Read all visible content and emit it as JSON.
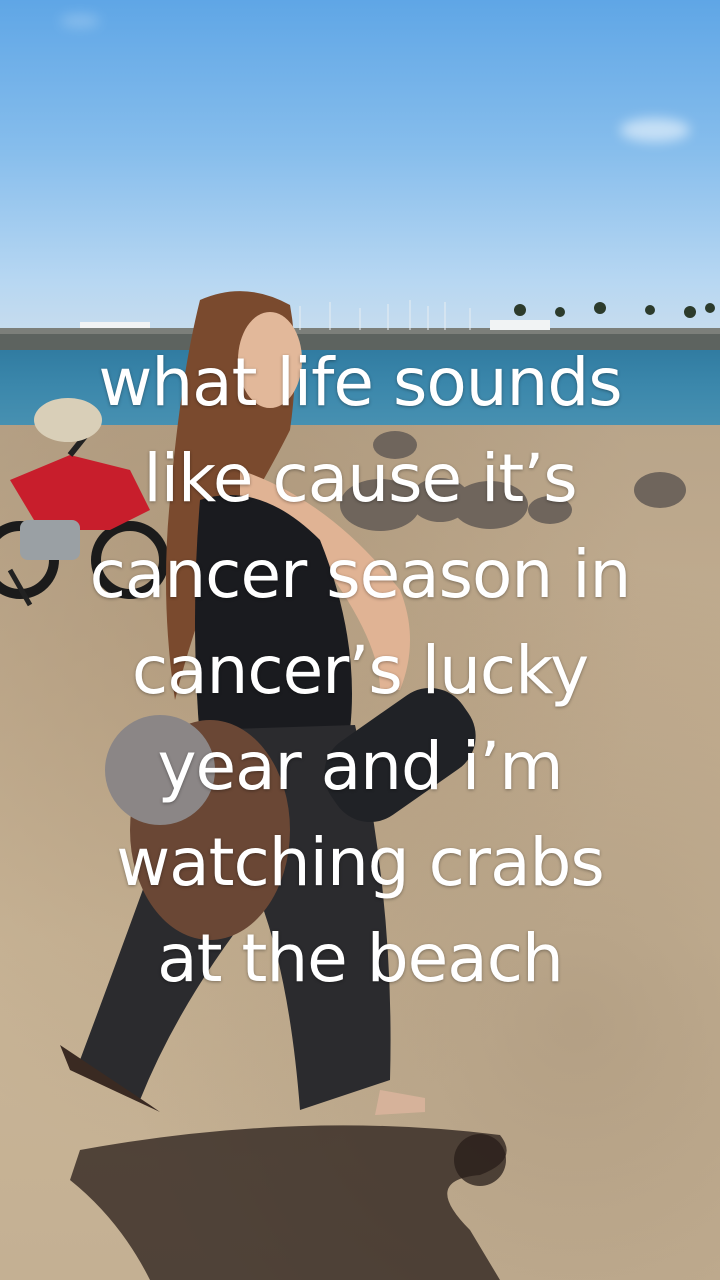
{
  "video": {
    "caption_overlay": "what life sounds\nlike cause it’s\ncancer season in\ncancer’s lucky\nyear and i’m\nwatching crabs\nat the beach"
  },
  "scene": {
    "sky_color": "#86bdec",
    "sea_color": "#3b87ab",
    "sand_color": "#c2ad90",
    "subjects": [
      "person-walking",
      "motorcycle",
      "helmet",
      "rocks",
      "harbor-boats",
      "shadow"
    ]
  }
}
